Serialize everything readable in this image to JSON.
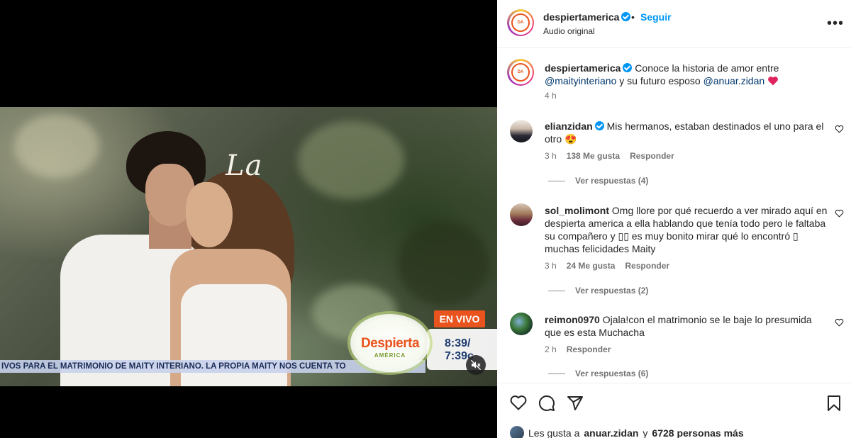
{
  "video": {
    "script_word": "La",
    "live_badge": "EN VIVO",
    "logo_main": "Despierta",
    "logo_sub": "AMÉRICA",
    "time_central": "8:39/",
    "time_pacific": "7:39c",
    "ticker": "IVOS PARA EL MATRIMONIO DE MAITY INTERIANO. LA PROPIA MAITY NOS CUENTA TO"
  },
  "header": {
    "username": "despiertamerica",
    "dot": "•",
    "follow_label": "Seguir",
    "subtitle": "Audio original",
    "more": "•••"
  },
  "caption": {
    "username": "despiertamerica",
    "text_1": " Conoce la historia de amor entre",
    "mention_1": "@maityinteriano",
    "text_2": " y su futuro esposo ",
    "mention_2": "@anuar.zidan",
    "time": "4 h"
  },
  "comments": [
    {
      "username": "elianzidan",
      "text": " Mis hermanos, estaban destinados el uno para el otro 😍",
      "time": "3 h",
      "likes": "138 Me gusta",
      "reply": "Responder",
      "view_replies": "Ver respuestas (4)"
    },
    {
      "username": "sol_molimont",
      "text": " Omg llore por qué recuerdo a ver mirado aquí en despierta america a ella hablando que tenía todo pero le faltaba su compañero y ▯▯ es muy bonito mirar qué lo encontró ▯ muchas felicidades Maity",
      "time": "3 h",
      "likes": "24 Me gusta",
      "reply": "Responder",
      "view_replies": "Ver respuestas (2)"
    },
    {
      "username": "reimon0970",
      "text": " Ojala!con el matrimonio se le baje lo presumida que es esta Muchacha",
      "time": "2 h",
      "reply": "Responder",
      "view_replies": "Ver respuestas (6)"
    }
  ],
  "likes": {
    "prefix": "Les gusta a",
    "user": "anuar.zidan",
    "middle": "y",
    "others": "6728 personas más"
  },
  "colors": {
    "accent": "#0095f6",
    "heart": "#ed4956",
    "brand_orange": "#e9531d"
  }
}
